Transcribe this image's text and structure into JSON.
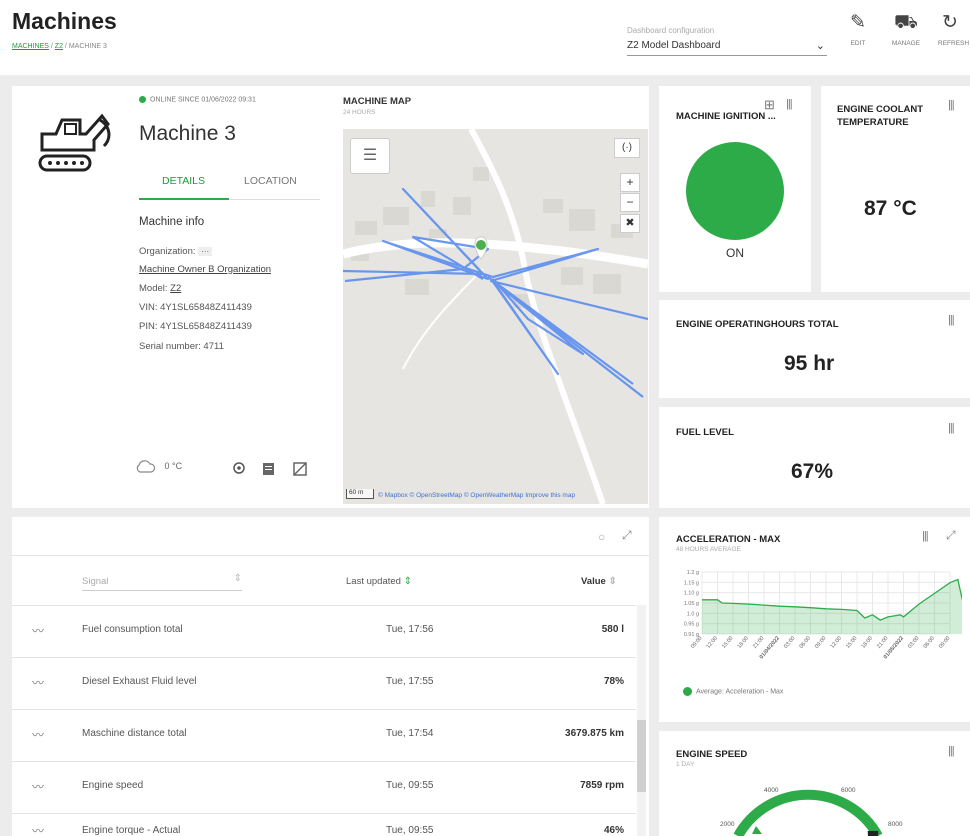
{
  "header": {
    "title": "Machines",
    "breadcrumb": [
      "MACHINES",
      "Z2",
      "MACHINE 3"
    ],
    "dashboard_label": "Dashboard configuration",
    "dashboard_value": "Z2 Model Dashboard",
    "tools": [
      {
        "label": "EDIT",
        "icon": "pencil-icon"
      },
      {
        "label": "MANAGE",
        "icon": "tractor-icon"
      },
      {
        "label": "REFRESH",
        "icon": "refresh-icon"
      }
    ]
  },
  "machine": {
    "online": "ONLINE SINCE 01/06/2022 09:31",
    "name": "Machine 3",
    "tabs": [
      "DETAILS",
      "LOCATION"
    ],
    "info_title": "Machine info",
    "org_label": "Organization:",
    "org_more": "···",
    "org_value": "Machine Owner B Organization",
    "model_label": "Model:",
    "model_value": "Z2",
    "vin": "VIN: 4Y1SL65848Z411439",
    "pin": "PIN: 4Y1SL65848Z411439",
    "serial": "Serial number: 4711",
    "temperature": "0 °C"
  },
  "map": {
    "title": "MACHINE MAP",
    "subtitle": "24 HOURS",
    "scale": "60 m",
    "attribution": "© Mapbox © OpenStreetMap © OpenWeatherMap Improve this map",
    "controls": [
      "+",
      "−"
    ]
  },
  "cards": {
    "ignition": {
      "title": "MACHINE IGNITION",
      "value": "ON",
      "color": "#2eab49"
    },
    "coolant": {
      "title": "ENGINE COOLANT TEMPERATURE",
      "value": "87 °C"
    },
    "hours": {
      "title": "ENGINE OPERATINGHOURS TOTAL",
      "value": "95 hr"
    },
    "fuel": {
      "title": "FUEL LEVEL",
      "value": "67%"
    },
    "accel": {
      "title": "ACCELERATION - MAX",
      "subtitle": "48 HOURS AVERAGE"
    },
    "speed": {
      "title": "ENGINE SPEED",
      "subtitle": "1 DAY",
      "ticks": [
        "2000",
        "4000",
        "6000",
        "8000"
      ]
    }
  },
  "table": {
    "headers": {
      "signal": "Signal",
      "updated": "Last updated",
      "value": "Value"
    },
    "rows": [
      {
        "signal": "Fuel consumption total",
        "updated": "Tue, 17:56",
        "value": "580 l"
      },
      {
        "signal": "Diesel Exhaust Fluid level",
        "updated": "Tue, 17:55",
        "value": "78%"
      },
      {
        "signal": "Maschine distance total",
        "updated": "Tue, 17:54",
        "value": "3679.875 km"
      },
      {
        "signal": "Engine speed",
        "updated": "Tue, 09:55",
        "value": "7859 rpm"
      },
      {
        "signal": "Engine torque - Actual",
        "updated": "Tue, 09:55",
        "value": "46%"
      }
    ]
  },
  "chart_data": {
    "type": "area",
    "title": "ACCELERATION - MAX",
    "subtitle": "48 HOURS AVERAGE",
    "yticks": [
      "1.2 g",
      "1.15 g",
      "1.10 g",
      "1.05 g",
      "1.0 g",
      "0.95 g",
      "0.91 g"
    ],
    "xticks": [
      "09:00",
      "12:00",
      "15:00",
      "18:00",
      "21:00",
      "01/04/2022",
      "03:00",
      "06:00",
      "09:00",
      "12:00",
      "15:00",
      "18:00",
      "21:00",
      "01/05/2022",
      "03:00",
      "06:00",
      "09:00"
    ],
    "ylim": [
      0.91,
      1.2
    ],
    "x": [
      0,
      1,
      1.3,
      2,
      3,
      4,
      5,
      6,
      7,
      8,
      9,
      10,
      10.5,
      11,
      11.5,
      12,
      12.8,
      13,
      14,
      15,
      16,
      16.5,
      16.8
    ],
    "y": [
      1.07,
      1.07,
      1.055,
      1.053,
      1.05,
      1.045,
      1.04,
      1.037,
      1.033,
      1.028,
      1.025,
      1.02,
      0.985,
      1.0,
      0.975,
      0.99,
      1.0,
      0.99,
      1.05,
      1.1,
      1.15,
      1.165,
      1.07
    ],
    "legend": "Average: Acceleration - Max",
    "color": "#2eab49"
  }
}
